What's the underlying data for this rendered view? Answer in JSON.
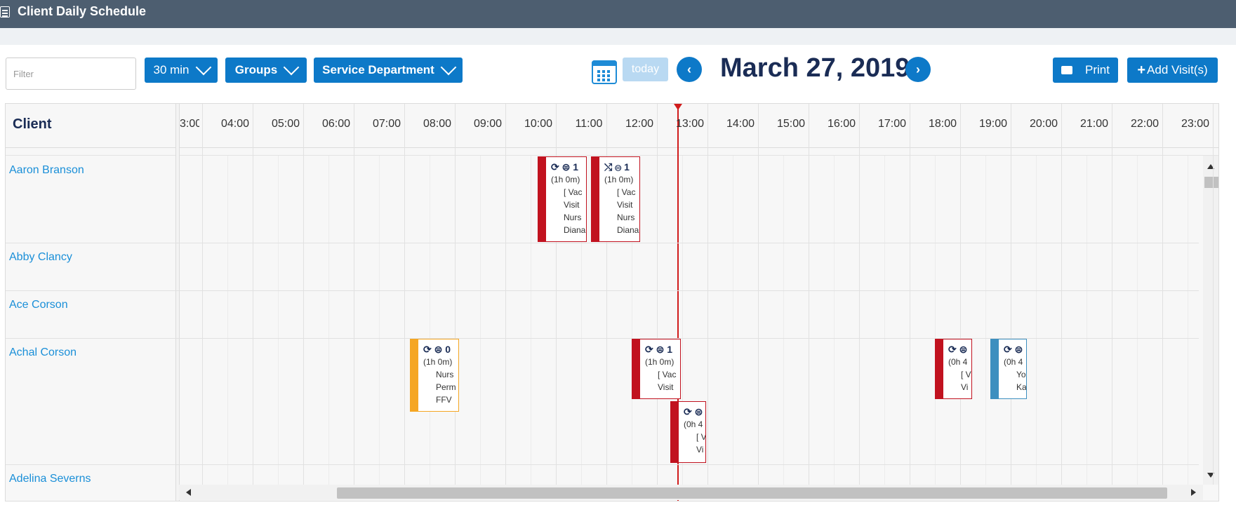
{
  "header": {
    "title": "Client Daily Schedule",
    "icon": "calendar-grid-icon"
  },
  "toolbar": {
    "filter_placeholder": "Filter",
    "interval_label": "30 min",
    "groups_label": "Groups",
    "department_label": "Service Department",
    "today_label": "today",
    "prev_icon": "‹",
    "next_icon": "›",
    "date": "March 27, 2019",
    "print_label": "Print",
    "add_visit_label": "Add Visit(s)"
  },
  "grid": {
    "client_header": "Client",
    "hours": [
      "3:00",
      "04:00",
      "05:00",
      "06:00",
      "07:00",
      "08:00",
      "09:00",
      "10:00",
      "11:00",
      "12:00",
      "13:00",
      "14:00",
      "15:00",
      "16:00",
      "17:00",
      "18:00",
      "19:00",
      "20:00",
      "21:00",
      "22:00",
      "23:00"
    ],
    "clients": [
      "Aaron Branson",
      "Abby Clancy",
      "Ace Corson",
      "Achal Corson",
      "Adelina Severns"
    ]
  },
  "appointments": [
    {
      "client": "Aaron Branson",
      "color": "red",
      "icons": "⟳ ⊜ 1",
      "duration": "(1h 0m)",
      "lines": [
        "[ Vac",
        "Visit",
        "Nurs",
        "Diana"
      ]
    },
    {
      "client": "Aaron Branson",
      "color": "red",
      "icons": "⤭ ⊜ 1",
      "duration": "(1h 0m)",
      "lines": [
        "[ Vac",
        "Visit",
        "Nurs",
        "Diana"
      ]
    },
    {
      "client": "Achal Corson",
      "color": "orange",
      "icons": "⟳ ⊜ 0",
      "duration": "(1h 0m)",
      "lines": [
        "Nurs",
        "Perm",
        "FFV"
      ]
    },
    {
      "client": "Achal Corson",
      "color": "red",
      "icons": "⟳ ⊜ 1",
      "duration": "(1h 0m)",
      "lines": [
        "[ Vac",
        "Visit"
      ]
    },
    {
      "client": "Achal Corson",
      "color": "red",
      "icons": "⟳ ⊜",
      "duration": "(0h 4",
      "lines": [
        "[ V",
        "Vi"
      ]
    },
    {
      "client": "Achal Corson",
      "color": "red",
      "icons": "⟳ ⊜",
      "duration": "(0h 4",
      "lines": [
        "[ V",
        "Vi"
      ]
    },
    {
      "client": "Achal Corson",
      "color": "blue",
      "icons": "⟳ ⊜",
      "duration": "(0h 4",
      "lines": [
        "Yo",
        "Ka"
      ]
    }
  ],
  "colors": {
    "primary": "#0d79c8",
    "header": "#4d5e70",
    "now": "#d11c1c",
    "appt_red": "#c1121f",
    "appt_orange": "#f5a623",
    "appt_blue": "#3d8fbf"
  }
}
